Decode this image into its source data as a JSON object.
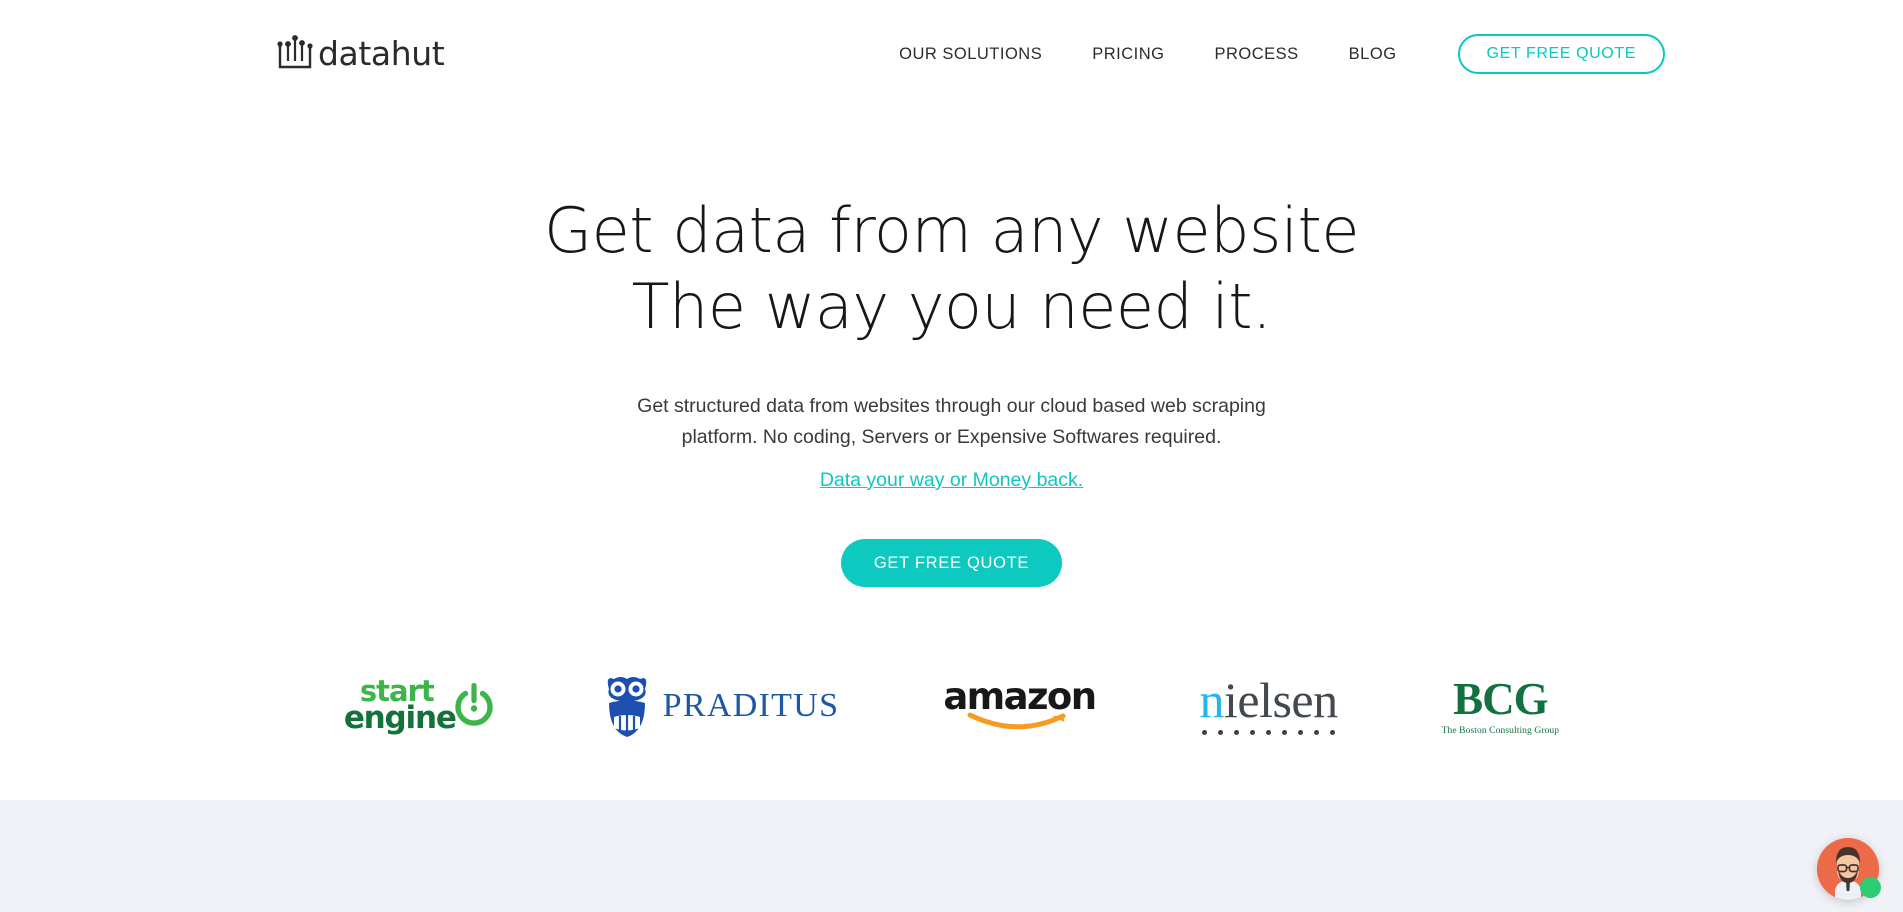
{
  "header": {
    "brand": {
      "name": "datahut",
      "logo_icon": "datahut-bars-logo"
    },
    "nav_items": [
      {
        "label": "OUR SOLUTIONS"
      },
      {
        "label": "PRICING"
      },
      {
        "label": "PROCESS"
      },
      {
        "label": "BLOG"
      }
    ],
    "cta": {
      "label": "GET FREE QUOTE"
    }
  },
  "hero": {
    "title_line1": "Get data from any website",
    "title_line2": "The way you need it.",
    "subtitle": "Get structured data from websites through our cloud based web scraping platform. No coding, Servers or Expensive Softwares required.",
    "subtitle_accent": "Data your way or Money back.",
    "cta": {
      "label": "GET FREE QUOTE"
    }
  },
  "clients": [
    {
      "name": "startengine",
      "text_primary": "start",
      "text_secondary": "engine"
    },
    {
      "name": "praditus",
      "text_primary": "PRADITUS"
    },
    {
      "name": "amazon",
      "text_primary": "amazon"
    },
    {
      "name": "nielsen",
      "text_primary": "n",
      "text_secondary": "ielsen"
    },
    {
      "name": "bcg",
      "text_primary": "BCG",
      "text_secondary": "The Boston Consulting Group"
    }
  ],
  "chat": {
    "avatar_icon": "support-agent-avatar",
    "status": "online"
  },
  "colors": {
    "accent_teal": "#0ec9c0",
    "heading": "#17171a",
    "body_text": "#3a3a3c",
    "panel_bg": "#f1f2f7",
    "chat_avatar_bg": "#ed6a49",
    "chat_status_green": "#2ecc71"
  }
}
